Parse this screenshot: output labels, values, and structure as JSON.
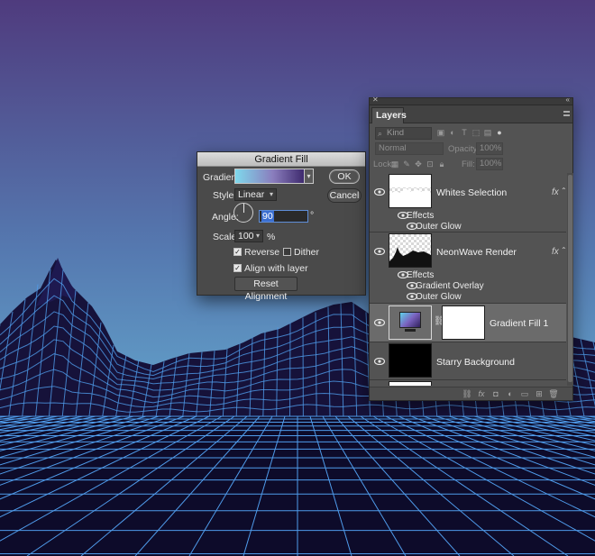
{
  "colors": {
    "sky_top": "#4f3b7e",
    "sky_bottom": "#6fc7e2",
    "grid_line": "#4f9bea",
    "terrain_fill": "#16123a",
    "ground_fill": "#0d0b2a",
    "dialog_bg": "#4a4a4a",
    "panel_bg": "#535353",
    "selected_row": "#6b6b6b",
    "input_focus": "#3b6fd1"
  },
  "gradient_fill_dialog": {
    "title": "Gradient Fill",
    "gradient_label": "Gradient:",
    "gradient_colors": [
      "#7fd9ec",
      "#8a7dbd",
      "#3e2a6e"
    ],
    "style_label": "Style:",
    "style_value": "Linear",
    "angle_label": "Angle:",
    "angle_value": "90",
    "degree_symbol": "°",
    "scale_label": "Scale:",
    "scale_value": "100",
    "percent_symbol": "%",
    "reverse_label": "Reverse",
    "reverse_checked": true,
    "dither_label": "Dither",
    "dither_checked": false,
    "align_label": "Align with layer",
    "align_checked": true,
    "reset_button": "Reset Alignment",
    "ok_button": "OK",
    "cancel_button": "Cancel"
  },
  "layers_panel": {
    "tab_label": "Layers",
    "kind_placeholder": "Kind",
    "blend_mode": "Normal",
    "opacity_label": "Opacity:",
    "opacity_value": "100%",
    "lock_label": "Lock:",
    "fill_label": "Fill:",
    "fill_value": "100%",
    "layers": [
      {
        "name": "Whites Selection",
        "has_fx": true,
        "fx_label": "fx",
        "effects_label": "Effects",
        "effects": [
          "Outer Glow"
        ]
      },
      {
        "name": "NeonWave Render",
        "has_fx": true,
        "fx_label": "fx",
        "effects_label": "Effects",
        "effects": [
          "Gradient Overlay",
          "Outer Glow"
        ]
      },
      {
        "name": "Gradient Fill 1",
        "selected": true
      },
      {
        "name": "Starry Background"
      }
    ],
    "footer_icons": [
      "link-icon",
      "fx-icon",
      "mask-icon",
      "adjustment-icon",
      "folder-icon",
      "new-layer-icon",
      "trash-icon"
    ]
  }
}
